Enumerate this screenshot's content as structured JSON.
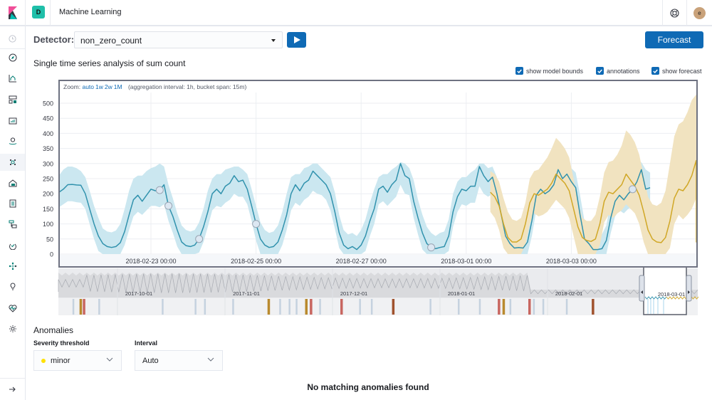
{
  "header": {
    "app_title": "Machine Learning",
    "space_initial": "D",
    "user_initial": "e"
  },
  "sidebar": {
    "items": [
      {
        "name": "recently-viewed",
        "icon": "clock-icon"
      },
      {
        "name": "discover",
        "icon": "compass-icon"
      },
      {
        "name": "visualize",
        "icon": "visualize-icon"
      },
      {
        "name": "dashboard",
        "icon": "dashboard-icon"
      },
      {
        "name": "canvas",
        "icon": "canvas-icon"
      },
      {
        "name": "maps",
        "icon": "map-pin-icon"
      },
      {
        "name": "machine-learning",
        "icon": "ml-icon",
        "active": true
      },
      {
        "name": "infrastructure",
        "icon": "infrastructure-icon"
      },
      {
        "name": "logs",
        "icon": "logs-icon"
      },
      {
        "name": "apm",
        "icon": "apm-icon"
      },
      {
        "name": "uptime",
        "icon": "uptime-icon"
      },
      {
        "name": "graph",
        "icon": "graph-icon"
      },
      {
        "name": "dev-tools",
        "icon": "wrench-icon"
      },
      {
        "name": "monitoring",
        "icon": "heartbeat-icon"
      },
      {
        "name": "management",
        "icon": "gear-icon"
      }
    ],
    "collapse_icon": "arrow-right-icon"
  },
  "controls": {
    "detector_label": "Detector:",
    "detector_value": "non_zero_count",
    "forecast_label": "Forecast"
  },
  "section_title": "Single time series analysis of sum count",
  "checkboxes": [
    {
      "label": "show model bounds",
      "checked": true
    },
    {
      "label": "annotations",
      "checked": true
    },
    {
      "label": "show forecast",
      "checked": true
    }
  ],
  "zoom": {
    "prefix": "Zoom:",
    "options": [
      "auto",
      "1w",
      "2w",
      "1M"
    ],
    "info": "(aggregation interval: 1h, bucket span: 15m)"
  },
  "colors": {
    "actual": "#3192ad",
    "bounds": "#cbe7f0",
    "forecast": "#d0a726",
    "forecast_bounds": "#f1e3c0",
    "accent": "#0f6ab5",
    "minor": "#ffe100"
  },
  "chart_data": {
    "type": "line",
    "title": "Single time series analysis of sum count",
    "ylabel": "",
    "xlabel": "",
    "ylim": [
      0,
      500
    ],
    "yticks": [
      0,
      50,
      100,
      150,
      200,
      250,
      300,
      350,
      400,
      450,
      500
    ],
    "xticks": [
      "2018-02-23 00:00",
      "2018-02-25 00:00",
      "2018-02-27 00:00",
      "2018-03-01 00:00",
      "2018-03-03 00:00"
    ],
    "x_start_day": -1.75,
    "points_per_day": 12,
    "forecast_start_day": 6.46,
    "x_end_day": 10.4,
    "grid": true,
    "series": [
      {
        "name": "actual",
        "values": [
          205,
          215,
          230,
          231,
          229,
          228,
          200,
          150,
          100,
          60,
          35,
          25,
          22,
          25,
          38,
          75,
          130,
          180,
          195,
          175,
          195,
          215,
          210,
          212,
          230,
          160,
          125,
          80,
          40,
          28,
          25,
          30,
          50,
          90,
          140,
          200,
          215,
          200,
          225,
          235,
          260,
          240,
          245,
          215,
          160,
          100,
          50,
          30,
          22,
          25,
          40,
          80,
          130,
          200,
          230,
          210,
          235,
          245,
          275,
          260,
          245,
          230,
          200,
          140,
          70,
          30,
          18,
          25,
          15,
          30,
          60,
          110,
          150,
          215,
          225,
          205,
          230,
          245,
          300,
          260,
          250,
          175,
          120,
          70,
          35,
          22,
          18,
          22,
          25,
          60,
          140,
          190,
          215,
          210,
          225,
          225,
          290,
          260,
          240,
          255,
          200,
          130,
          60,
          35,
          20,
          22,
          20,
          40,
          110,
          195,
          215,
          200,
          210,
          230,
          280,
          250,
          265,
          240,
          220,
          130,
          50,
          35,
          15,
          15,
          18,
          45,
          120,
          175,
          195,
          180,
          200,
          215,
          240,
          280,
          215,
          220
        ],
        "annotations_count": 6
      },
      {
        "name": "model_upper",
        "values": [
          260,
          280,
          290,
          290,
          285,
          275,
          255,
          210,
          160,
          120,
          85,
          75,
          72,
          78,
          100,
          150,
          210,
          250,
          260,
          260,
          275,
          285,
          290,
          300,
          290,
          230,
          185,
          135,
          95,
          80,
          75,
          80,
          105,
          150,
          210,
          250,
          265,
          265,
          280,
          285,
          290,
          290,
          280,
          265,
          215,
          160,
          105,
          80,
          70,
          75,
          95,
          140,
          200,
          255,
          265,
          265,
          285,
          290,
          300,
          300,
          285,
          270,
          255,
          205,
          130,
          80,
          65,
          70,
          60,
          80,
          115,
          170,
          215,
          255,
          265,
          265,
          280,
          290,
          305,
          300,
          285,
          245,
          180,
          130,
          90,
          70,
          60,
          70,
          75,
          115,
          200,
          240,
          255,
          255,
          270,
          280,
          300,
          300,
          285,
          290,
          255,
          185,
          120,
          85,
          68,
          70,
          68,
          95,
          170,
          240,
          255,
          250,
          260,
          275,
          300,
          300,
          300,
          285,
          270,
          195,
          110,
          85,
          60,
          60,
          66,
          95,
          175,
          225,
          240,
          235,
          250,
          270,
          290,
          305,
          280,
          270
        ],
        "values_lower": [
          155,
          165,
          175,
          175,
          172,
          170,
          150,
          100,
          50,
          10,
          0,
          0,
          0,
          0,
          0,
          30,
          80,
          125,
          140,
          130,
          145,
          160,
          160,
          155,
          165,
          110,
          70,
          25,
          0,
          0,
          0,
          0,
          5,
          40,
          90,
          145,
          160,
          155,
          170,
          180,
          200,
          190,
          190,
          165,
          110,
          45,
          0,
          0,
          0,
          0,
          0,
          30,
          80,
          145,
          170,
          160,
          180,
          190,
          210,
          200,
          195,
          180,
          145,
          85,
          20,
          0,
          0,
          0,
          0,
          0,
          10,
          60,
          100,
          165,
          175,
          160,
          175,
          190,
          230,
          200,
          195,
          120,
          65,
          15,
          0,
          0,
          0,
          0,
          0,
          10,
          90,
          140,
          165,
          160,
          170,
          170,
          225,
          200,
          190,
          200,
          145,
          75,
          10,
          0,
          0,
          0,
          0,
          0,
          60,
          145,
          165,
          150,
          160,
          180,
          215,
          195,
          205,
          185,
          165,
          80,
          0,
          0,
          0,
          0,
          0,
          0,
          70,
          125,
          145,
          135,
          150,
          160,
          185,
          220,
          165,
          170
        ]
      },
      {
        "name": "forecast",
        "values": [
          205,
          190,
          160,
          100,
          55,
          40,
          40,
          50,
          100,
          170,
          200,
          195,
          205,
          215,
          235,
          265,
          250,
          235,
          210,
          150,
          90,
          55,
          45,
          42,
          50,
          100,
          175,
          205,
          200,
          215,
          230,
          265,
          245,
          225,
          195,
          140,
          80,
          50,
          40,
          38,
          55,
          110,
          185,
          215,
          210,
          230,
          260,
          310,
          290,
          260,
          200,
          140,
          70,
          50,
          40,
          45,
          60,
          120,
          195,
          230,
          225,
          240,
          270,
          300
        ]
      },
      {
        "name": "forecast_upper",
        "values": [
          275,
          265,
          240,
          185,
          140,
          115,
          110,
          120,
          170,
          250,
          275,
          280,
          300,
          320,
          350,
          385,
          370,
          350,
          320,
          250,
          170,
          120,
          110,
          110,
          130,
          190,
          270,
          305,
          310,
          330,
          360,
          410,
          395,
          370,
          330,
          260,
          190,
          165,
          160,
          170,
          210,
          300,
          390,
          430,
          440,
          470,
          510,
          560,
          540,
          500,
          440,
          340,
          240,
          195,
          180,
          200,
          250,
          320,
          380,
          420,
          440,
          460,
          490,
          500
        ],
        "values_lower": [
          140,
          120,
          80,
          20,
          0,
          0,
          0,
          0,
          30,
          100,
          135,
          125,
          130,
          140,
          160,
          180,
          165,
          150,
          120,
          60,
          0,
          0,
          0,
          0,
          0,
          30,
          105,
          130,
          120,
          135,
          145,
          165,
          150,
          135,
          100,
          40,
          0,
          0,
          0,
          0,
          0,
          20,
          100,
          130,
          115,
          130,
          150,
          185,
          165,
          150,
          100,
          40,
          0,
          0,
          0,
          0,
          0,
          45,
          120,
          150,
          140,
          150,
          170,
          200
        ]
      }
    ],
    "context": {
      "xticks": [
        "2017-10-01",
        "2017-11-01",
        "2017-12-01",
        "2018-01-01",
        "2018-02-01",
        "2018-03-01"
      ],
      "anomaly_markers": [
        {
          "pos": 0.03,
          "color": "#d5dde5"
        },
        {
          "pos": 0.045,
          "color": "#b98a2e"
        },
        {
          "pos": 0.052,
          "color": "#c86660"
        },
        {
          "pos": 0.085,
          "color": "#d5dde5"
        },
        {
          "pos": 0.22,
          "color": "#d5dde5"
        },
        {
          "pos": 0.29,
          "color": "#d5dde5"
        },
        {
          "pos": 0.31,
          "color": "#d5dde5"
        },
        {
          "pos": 0.37,
          "color": "#d5dde5"
        },
        {
          "pos": 0.445,
          "color": "#b98a2e"
        },
        {
          "pos": 0.47,
          "color": "#d5dde5"
        },
        {
          "pos": 0.49,
          "color": "#d5dde5"
        },
        {
          "pos": 0.505,
          "color": "#d5dde5"
        },
        {
          "pos": 0.525,
          "color": "#b98a2e"
        },
        {
          "pos": 0.535,
          "color": "#c86660"
        },
        {
          "pos": 0.555,
          "color": "#d5dde5"
        },
        {
          "pos": 0.6,
          "color": "#c86660"
        },
        {
          "pos": 0.64,
          "color": "#d5dde5"
        },
        {
          "pos": 0.665,
          "color": "#d5dde5"
        },
        {
          "pos": 0.71,
          "color": "#a0522d"
        },
        {
          "pos": 0.79,
          "color": "#d5dde5"
        },
        {
          "pos": 0.85,
          "color": "#d5dde5"
        },
        {
          "pos": 0.895,
          "color": "#d5dde5"
        },
        {
          "pos": 0.935,
          "color": "#c86660"
        },
        {
          "pos": 0.945,
          "color": "#b98a2e"
        },
        {
          "pos": 0.96,
          "color": "#d5dde5"
        },
        {
          "pos": 1.0,
          "color": "#c86660"
        },
        {
          "pos": 1.01,
          "color": "#d5dde5"
        },
        {
          "pos": 1.03,
          "color": "#d5dde5"
        },
        {
          "pos": 1.08,
          "color": "#d5dde5"
        },
        {
          "pos": 1.135,
          "color": "#a0522d"
        },
        {
          "pos": 1.28,
          "color": "#d5dde5"
        },
        {
          "pos": 1.32,
          "color": "#d5dde5"
        }
      ],
      "brush_label": "2018-03-01"
    }
  },
  "anomalies": {
    "title": "Anomalies",
    "severity_label": "Severity threshold",
    "severity_value": "minor",
    "interval_label": "Interval",
    "interval_value": "Auto",
    "empty_message": "No matching anomalies found"
  }
}
